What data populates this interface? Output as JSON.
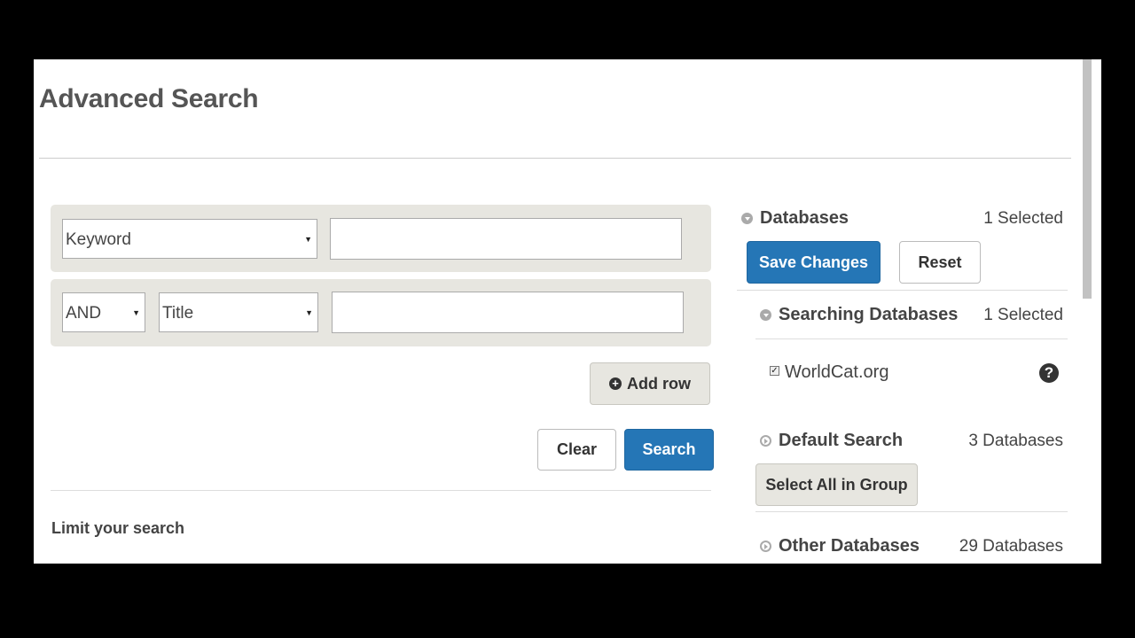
{
  "page": {
    "title": "Advanced Search"
  },
  "search": {
    "row1": {
      "field": "Keyword",
      "value": ""
    },
    "row2": {
      "operator": "AND",
      "field": "Title",
      "value": ""
    },
    "add_row_label": "Add row",
    "clear_label": "Clear",
    "search_label": "Search",
    "limit_label": "Limit your search"
  },
  "databases": {
    "title": "Databases",
    "selected_count": "1 Selected",
    "save_label": "Save Changes",
    "reset_label": "Reset",
    "searching": {
      "title": "Searching Databases",
      "count": "1 Selected",
      "items": [
        {
          "name": "WorldCat.org",
          "checked": true
        }
      ]
    },
    "default_search": {
      "title": "Default Search",
      "count": "3 Databases",
      "select_all_label": "Select All in Group"
    },
    "other": {
      "title": "Other Databases",
      "count": "29 Databases"
    }
  },
  "colors": {
    "accent": "#2576b6",
    "panel": "#e7e6e0"
  },
  "icons": {
    "add_row": "plus-circle-icon",
    "section_open": "chevron-down-circle-icon",
    "section_closed": "chevron-right-circle-icon",
    "help": "question-circle-icon"
  }
}
